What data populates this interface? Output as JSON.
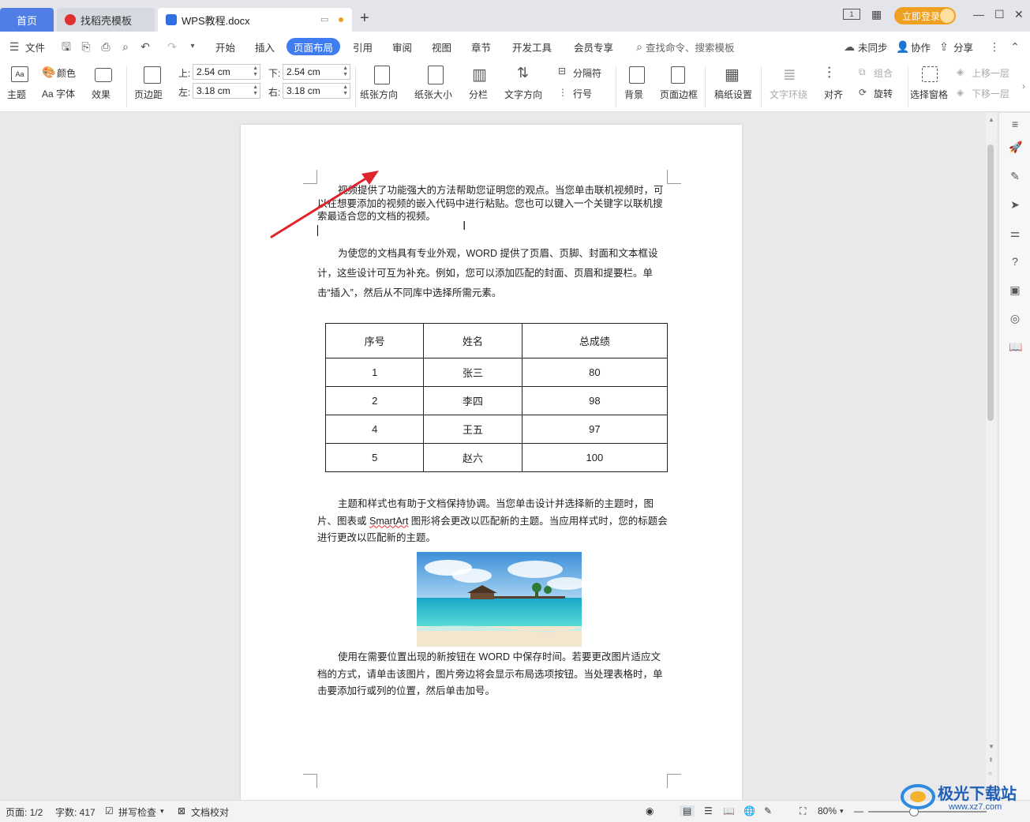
{
  "tabs": {
    "home": "首页",
    "template": "找稻壳模板",
    "document": "WPS教程.docx",
    "login": "立即登录"
  },
  "menu": {
    "file": "文件",
    "items": [
      "开始",
      "插入",
      "页面布局",
      "引用",
      "审阅",
      "视图",
      "章节",
      "开发工具",
      "会员专享"
    ],
    "active": "页面布局",
    "search_placeholder": "查找命令、搜索模板",
    "sync": "未同步",
    "collab": "协作",
    "share": "分享"
  },
  "ribbon": {
    "theme": "主题",
    "color": "颜色",
    "font": "Aa 字体",
    "effect": "效果",
    "margins": "页边距",
    "top_label": "上:",
    "top_value": "2.54 cm",
    "bottom_label": "下:",
    "bottom_value": "2.54 cm",
    "left_label": "左:",
    "left_value": "3.18 cm",
    "right_label": "右:",
    "right_value": "3.18 cm",
    "orientation": "纸张方向",
    "size": "纸张大小",
    "columns": "分栏",
    "text_direction": "文字方向",
    "breaks": "分隔符",
    "line_numbers": "行号",
    "background": "背景",
    "page_border": "页面边框",
    "manuscript": "稿纸设置",
    "text_wrap": "文字环绕",
    "align": "对齐",
    "group": "组合",
    "rotate": "旋转",
    "selection_pane": "选择窗格",
    "bring_forward": "上移一层",
    "send_backward": "下移一层"
  },
  "document": {
    "p1": "视频提供了功能强大的方法帮助您证明您的观点。当您单击联机视频时，可以在想要添加的视频的嵌入代码中进行粘贴。您也可以键入一个关键字以联机搜索最适合您的文档的视频。",
    "p2": "为使您的文档具有专业外观，WORD 提供了页眉、页脚、封面和文本框设计，这些设计可互为补充。例如，您可以添加匹配的封面、页眉和提要栏。单击“插入”，然后从不同库中选择所需元素。",
    "p3a": "主题和样式也有助于文档保持协调。当您单击设计并选择新的主题时，图片、图表或 ",
    "p3_smartart": "SmartArt",
    "p3b": " 图形将会更改以匹配新的主题。当应用样式时，您的标题会进行更改以匹配新的主题。",
    "p4": "使用在需要位置出现的新按钮在 WORD 中保存时间。若要更改图片适应文档的方式，请单击该图片，图片旁边将会显示布局选项按钮。当处理表格时，单击要添加行或列的位置，然后单击加号。",
    "table": {
      "headers": [
        "序号",
        "姓名",
        "总成绩"
      ],
      "rows": [
        [
          "1",
          "张三",
          "80"
        ],
        [
          "2",
          "李四",
          "98"
        ],
        [
          "4",
          "王五",
          "97"
        ],
        [
          "5",
          "赵六",
          "100"
        ]
      ]
    }
  },
  "status": {
    "page": "页面: 1/2",
    "words": "字数: 417",
    "spell": "拼写检查",
    "proof": "文档校对",
    "zoom": "80%"
  },
  "watermark": {
    "name": "极光下载站",
    "url": "www.xz7.com"
  },
  "colors": {
    "accent": "#3f7cf0",
    "arrow": "#e0242b",
    "login": "#f0a020"
  }
}
